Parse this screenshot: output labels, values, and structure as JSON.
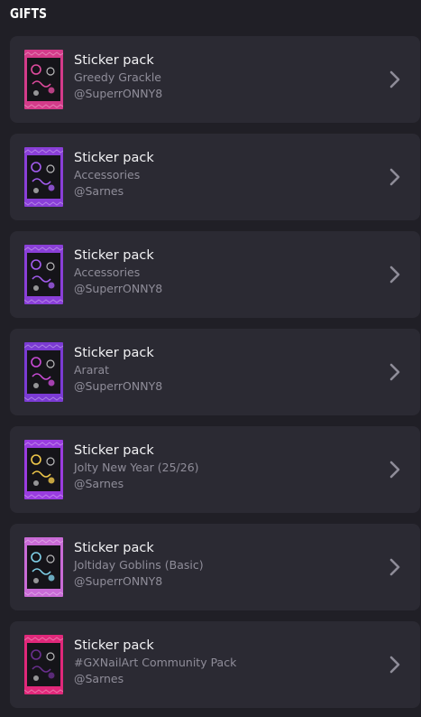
{
  "section": {
    "title": "GIFTS"
  },
  "gifts": [
    {
      "title": "Sticker pack",
      "name": "Greedy Grackle",
      "sender": "@SuperrONNY8",
      "icon": "sticker-pack-greedy-grackle-icon",
      "colors": {
        "band": "#d43b8a",
        "accent": "#e04b9e"
      }
    },
    {
      "title": "Sticker pack",
      "name": "Accessories",
      "sender": "@Sarnes",
      "icon": "sticker-pack-accessories-icon",
      "colors": {
        "band": "#8a3fd8",
        "accent": "#a45cf0"
      }
    },
    {
      "title": "Sticker pack",
      "name": "Accessories",
      "sender": "@SuperrONNY8",
      "icon": "sticker-pack-accessories-icon",
      "colors": {
        "band": "#8a3fd8",
        "accent": "#a45cf0"
      }
    },
    {
      "title": "Sticker pack",
      "name": "Ararat",
      "sender": "@SuperrONNY8",
      "icon": "sticker-pack-ararat-icon",
      "colors": {
        "band": "#7b3bd4",
        "accent": "#c94bd6"
      }
    },
    {
      "title": "Sticker pack",
      "name": "Jolty New Year (25/26)",
      "sender": "@Sarnes",
      "icon": "sticker-pack-jolty-new-year-icon",
      "colors": {
        "band": "#9a3ce0",
        "accent": "#f0c84a"
      }
    },
    {
      "title": "Sticker pack",
      "name": "Joltiday Goblins (Basic)",
      "sender": "@SuperrONNY8",
      "icon": "sticker-pack-joltiday-goblins-icon",
      "colors": {
        "band": "#c96bd6",
        "accent": "#7fd0e8"
      }
    },
    {
      "title": "Sticker pack",
      "name": "#GXNailArt Community Pack",
      "sender": "@Sarnes",
      "icon": "sticker-pack-gxnailart-icon",
      "colors": {
        "band": "#e0287a",
        "accent": "#6a2f8f"
      }
    }
  ]
}
